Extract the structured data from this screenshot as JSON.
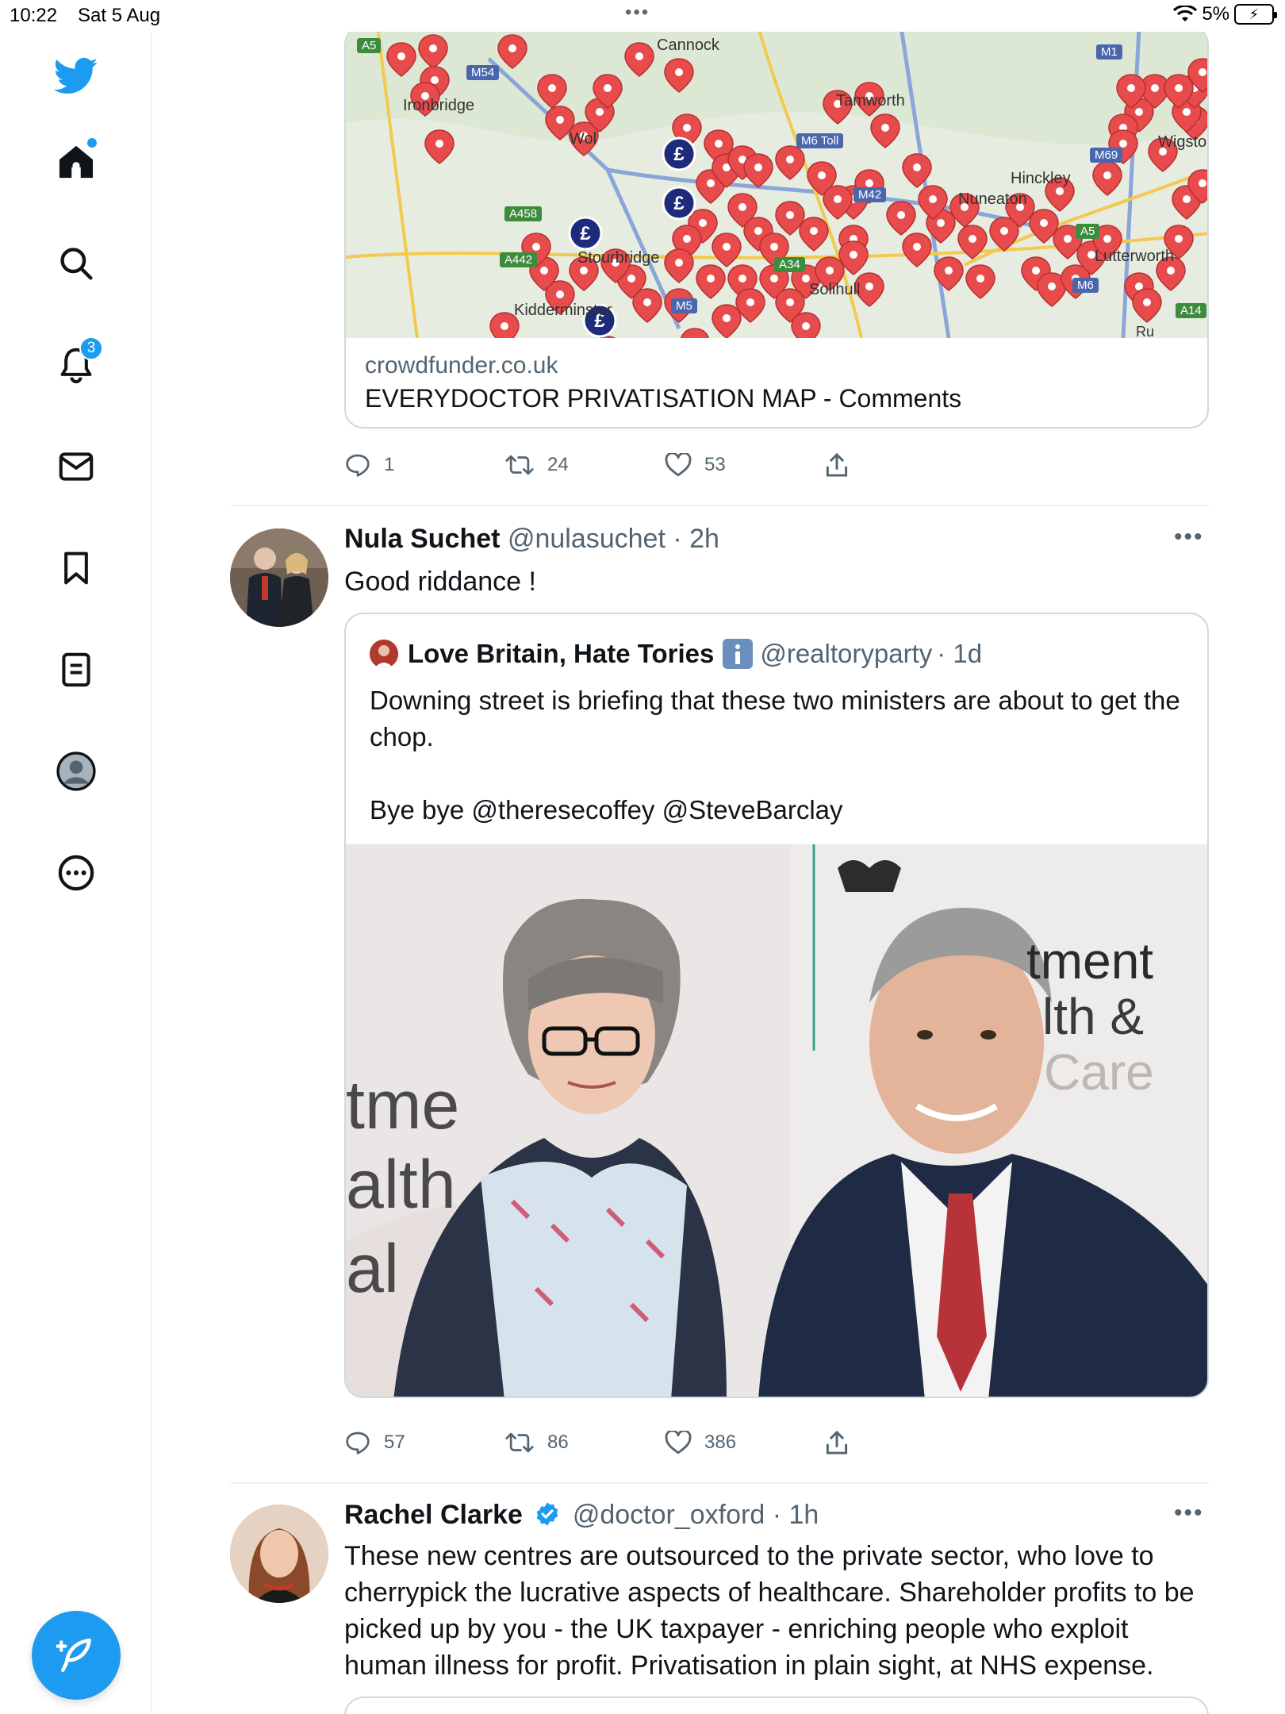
{
  "status_bar": {
    "time": "10:22",
    "date": "Sat 5 Aug",
    "battery": "5%"
  },
  "sidebar": {
    "items": [
      {
        "name": "home",
        "icon": "home-icon"
      },
      {
        "name": "explore",
        "icon": "search-icon"
      },
      {
        "name": "notifications",
        "icon": "bell-icon",
        "badge": "3"
      },
      {
        "name": "messages",
        "icon": "mail-icon"
      },
      {
        "name": "bookmarks",
        "icon": "bookmark-icon"
      },
      {
        "name": "lists",
        "icon": "list-icon"
      },
      {
        "name": "profile",
        "icon": "profile-icon"
      },
      {
        "name": "more",
        "icon": "more-icon"
      }
    ]
  },
  "link_card": {
    "domain": "crowdfunder.co.uk",
    "title": "EVERYDOCTOR PRIVATISATION MAP - Comments",
    "map_labels": [
      "A5",
      "M54",
      "Cannock",
      "M1",
      "Ironbridge",
      "Tamworth",
      "Wigsto",
      "M6 Toll",
      "M69",
      "Hinckley",
      "Nuneaton",
      "A458",
      "A5",
      "A442",
      "Stourbridge",
      "Lutterworth",
      "M6",
      "Kidderminster",
      "Solihull",
      "A14",
      "M42",
      "A34",
      "M5",
      "Wol",
      "Ru"
    ]
  },
  "tweet1_actions": {
    "replies": "1",
    "retweets": "24",
    "likes": "53"
  },
  "tweet2": {
    "name": "Nula Suchet",
    "handle": "@nulasuchet",
    "time": "· 2h",
    "text": "Good riddance !",
    "quote": {
      "name": "Love Britain, Hate Tories",
      "handle": "@realtoryparty",
      "time": "· 1d",
      "line1": "Downing street is briefing that these two ministers are about to get the chop.",
      "line2": "Bye bye @theresecoffey @SteveBarclay",
      "image_text": [
        "tment",
        "lth &",
        "Care",
        "tme",
        "alth",
        "al"
      ]
    },
    "actions": {
      "replies": "57",
      "retweets": "86",
      "likes": "386"
    }
  },
  "tweet3": {
    "name": "Rachel Clarke",
    "handle": "@doctor_oxford",
    "time": "· 1h",
    "text": "These new centres are outsourced to the private sector, who love to cherrypick the lucrative aspects of healthcare. Shareholder profits to be picked up by you - the UK taxpayer - enriching people who exploit human illness for profit. Privatisation in plain sight, at NHS expense."
  },
  "colors": {
    "accent": "#1d9bf0",
    "pin": "#e84b4b",
    "pound": "#1e2a7a"
  }
}
